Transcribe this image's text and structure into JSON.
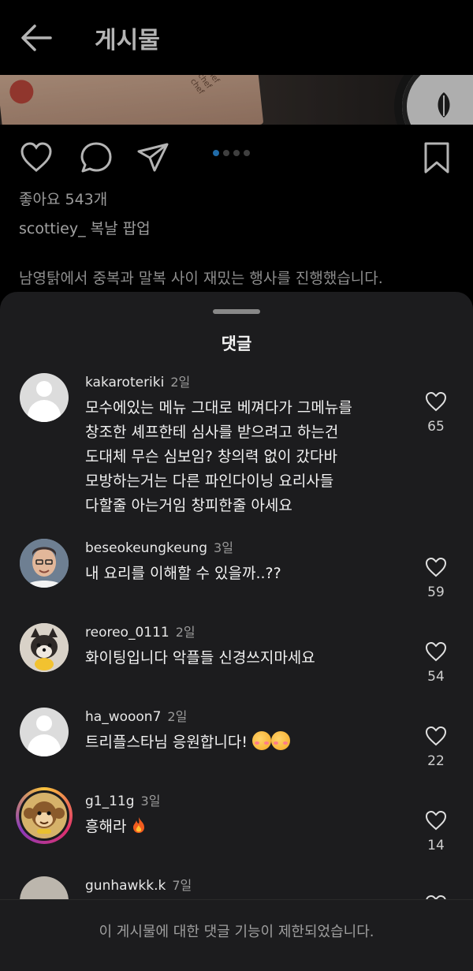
{
  "header": {
    "title": "게시물"
  },
  "post": {
    "likes": "좋아요 543개",
    "username": "scottiey_",
    "caption_title": "복날 팝업",
    "body_line": "남영탉에서 중복과 말복 사이 재밌는 행사를 진행했습니다."
  },
  "sheet": {
    "title": "댓글"
  },
  "comments": [
    {
      "user": "kakaroteriki",
      "time": "2일",
      "avatar": "default-avatar",
      "lines": [
        "모수에있는 메뉴 그대로 베껴다가 그메뉴를",
        "창조한 셰프한테 심사를 받으려고 하는건",
        "도대체 무슨 심보임? 창의력 없이 갔다바",
        "모방하는거는 다른 파인다이닝 요리사들",
        "다할줄 아는거임 창피한줄 아세요"
      ],
      "likes": "65"
    },
    {
      "user": "beseokeungkeung",
      "time": "3일",
      "avatar": "man-portrait",
      "lines": [
        "내 요리를 이해할 수 있을까..??"
      ],
      "likes": "59"
    },
    {
      "user": "reoreo_0111",
      "time": "2일",
      "avatar": "dog-photo",
      "lines": [
        "화이팅입니다 악플들 신경쓰지마세요"
      ],
      "likes": "54"
    },
    {
      "user": "ha_wooon7",
      "time": "2일",
      "avatar": "default-avatar",
      "lines": [
        "트리플스타님 응원합니다!"
      ],
      "likes": "22"
    },
    {
      "user": "g1_11g",
      "time": "3일",
      "avatar": "monkey-cartoon",
      "lines": [
        "흥해라"
      ],
      "likes": "14"
    },
    {
      "user": "gunhawkk.k",
      "time": "7일",
      "avatar": "partial",
      "lines": [],
      "likes": ""
    }
  ],
  "footer": {
    "notice": "이 게시물에 대한 댓글 기능이 제한되었습니다."
  },
  "colors": {
    "background": "#000000",
    "sheet": "#1c1c1e",
    "carousel_active": "#2b8fe0"
  }
}
